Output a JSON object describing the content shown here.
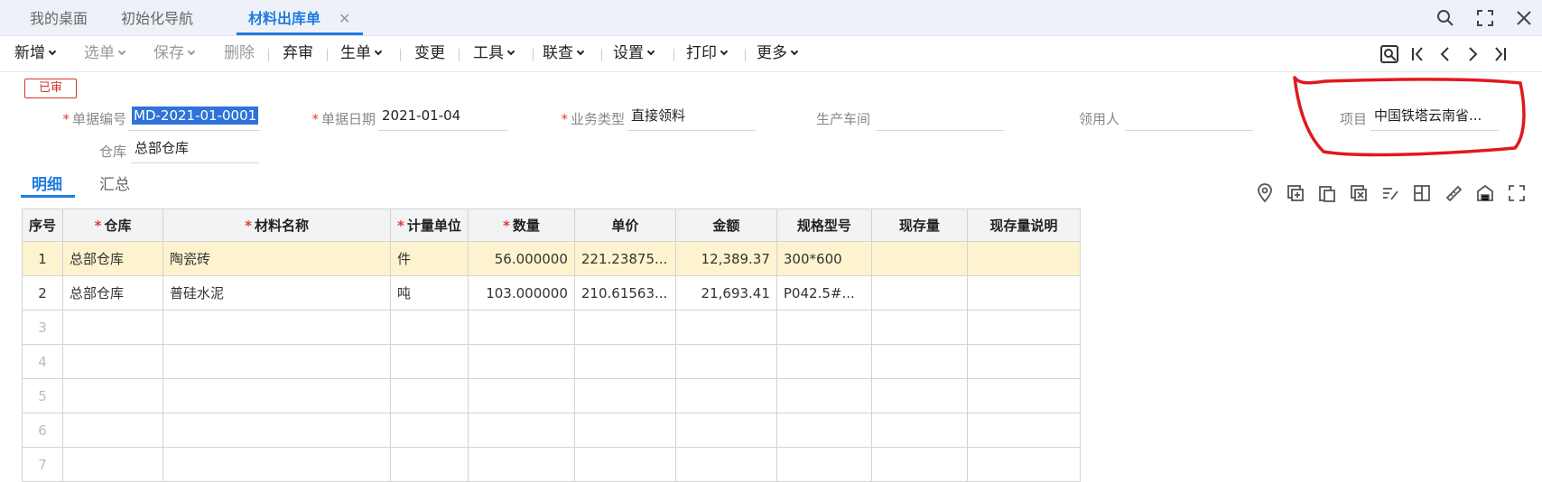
{
  "tabs": [
    {
      "label": "我的桌面"
    },
    {
      "label": "初始化导航"
    },
    {
      "label": "材料出库单"
    }
  ],
  "toolbar": {
    "items": [
      {
        "label": "新增"
      },
      {
        "label": "选单"
      },
      {
        "label": "保存"
      },
      {
        "label": "删除"
      },
      {
        "label": "弃审"
      },
      {
        "label": "生单"
      },
      {
        "label": "变更"
      },
      {
        "label": "工具"
      },
      {
        "label": "联查"
      },
      {
        "label": "设置"
      },
      {
        "label": "打印"
      },
      {
        "label": "更多"
      }
    ]
  },
  "form": {
    "status": "已审",
    "doc_no_label": "单据编号",
    "doc_no": "MD-2021-01-0001",
    "doc_date_label": "单据日期",
    "doc_date": "2021-01-04",
    "biz_type_label": "业务类型",
    "biz_type": "直接领料",
    "workshop_label": "生产车间",
    "workshop": "",
    "receiver_label": "领用人",
    "receiver": "",
    "project_label": "项目",
    "project": "中国铁塔云南省...",
    "warehouse_label": "仓库",
    "warehouse": "总部仓库"
  },
  "subtabs": [
    {
      "label": "明细"
    },
    {
      "label": "汇总"
    }
  ],
  "grid": {
    "columns": [
      "序号",
      "仓库",
      "材料名称",
      "计量单位",
      "数量",
      "单价",
      "金额",
      "规格型号",
      "现存量",
      "现存量说明"
    ],
    "rows": [
      [
        "1",
        "总部仓库",
        "陶瓷砖",
        "件",
        "56.000000",
        "221.23875...",
        "12,389.37",
        "300*600",
        "",
        ""
      ],
      [
        "2",
        "总部仓库",
        "普硅水泥",
        "吨",
        "103.000000",
        "210.61563...",
        "21,693.41",
        "P042.5#...",
        "",
        ""
      ],
      [
        "3",
        "",
        "",
        "",
        "",
        "",
        "",
        "",
        "",
        ""
      ],
      [
        "4",
        "",
        "",
        "",
        "",
        "",
        "",
        "",
        "",
        ""
      ],
      [
        "5",
        "",
        "",
        "",
        "",
        "",
        "",
        "",
        "",
        ""
      ],
      [
        "6",
        "",
        "",
        "",
        "",
        "",
        "",
        "",
        "",
        ""
      ],
      [
        "7",
        "",
        "",
        "",
        "",
        "",
        "",
        "",
        "",
        ""
      ]
    ]
  },
  "colors": {
    "accent": "#1f7be0",
    "status": "#d9302b",
    "selected_row": "#fdf3cf",
    "annotation": "#e0191f"
  }
}
